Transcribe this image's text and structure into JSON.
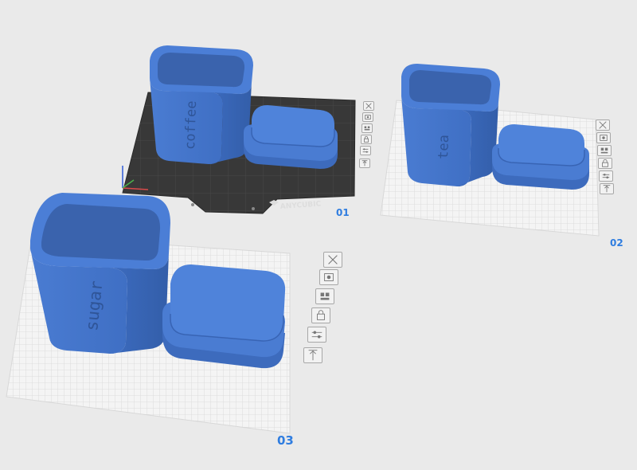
{
  "viewport": {
    "background": "#eaeaea",
    "model_color": "#4a7bd0",
    "model_shade": "#3862b3",
    "bed_dark": "#3b3b3b",
    "grid_light": "#dcdcdc",
    "accent": "#2f7de0"
  },
  "plates": [
    {
      "number": "01",
      "bed_type": "dark",
      "bed_brand": "ANYCUBIC",
      "objects": [
        {
          "kind": "canister",
          "label": "coffee"
        },
        {
          "kind": "lid"
        }
      ],
      "tools": [
        "close-icon",
        "auto-orient-icon",
        "arrange-icon",
        "lock-icon",
        "settings-icon",
        "move-up-icon"
      ]
    },
    {
      "number": "02",
      "bed_type": "light-grid",
      "objects": [
        {
          "kind": "canister",
          "label": "tea"
        },
        {
          "kind": "lid"
        }
      ],
      "tools": [
        "close-icon",
        "auto-orient-icon",
        "arrange-icon",
        "lock-icon",
        "settings-icon",
        "move-up-icon"
      ]
    },
    {
      "number": "03",
      "bed_type": "light-grid",
      "objects": [
        {
          "kind": "canister",
          "label": "sugar"
        },
        {
          "kind": "lid"
        }
      ],
      "tools": [
        "close-icon",
        "auto-orient-icon",
        "arrange-icon",
        "lock-icon",
        "settings-icon",
        "move-up-icon"
      ]
    }
  ]
}
